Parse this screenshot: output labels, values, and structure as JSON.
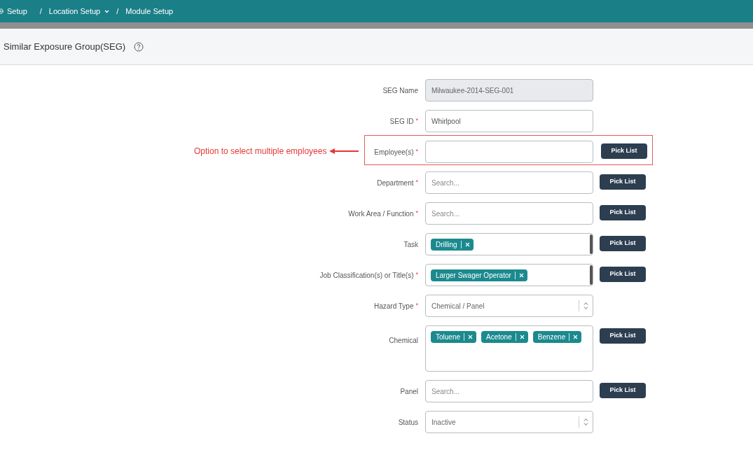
{
  "breadcrumbs": [
    {
      "kind": "home",
      "label": "Setup"
    },
    {
      "kind": "separator",
      "label": "/"
    },
    {
      "kind": "dropdown",
      "label": "Location Setup"
    },
    {
      "kind": "separator",
      "label": "/"
    },
    {
      "kind": "link",
      "label": "Module Setup"
    }
  ],
  "page_title": "Similar Exposure Group(SEG)",
  "fields": [
    {
      "kind": "text",
      "label": "SEG Name",
      "value": "Milwaukee-2014-SEG-001",
      "disabled": true
    },
    {
      "kind": "text",
      "label": "SEG ID",
      "required_mark": "*",
      "value": "Whirlpool",
      "disabled": false
    },
    {
      "kind": "text",
      "label": "Employee(s)",
      "required_mark": "*",
      "disabled": false,
      "pick_list": "Pick List",
      "annotation": "Option to select multiple employees"
    },
    {
      "kind": "text",
      "label": "Department",
      "required_mark": "*",
      "placeholder": "Search...",
      "disabled": false,
      "pick_list": "Pick List"
    },
    {
      "kind": "text",
      "label": "Work Area / Function",
      "required_mark": "*",
      "placeholder": "Search...",
      "disabled": false,
      "pick_list": "Pick List"
    },
    {
      "kind": "tags",
      "label": "Task",
      "tags": [
        "Drilling"
      ],
      "scrollable": true,
      "pick_list": "Pick List"
    },
    {
      "kind": "tags",
      "label": "Job Classification(s) or Title(s)",
      "required_mark": "*",
      "tags": [
        "Larger Swager Operator"
      ],
      "scrollable": true,
      "pick_list": "Pick List"
    },
    {
      "kind": "select",
      "label": "Hazard Type",
      "required_mark": "*",
      "value": "Chemical / Panel"
    },
    {
      "kind": "tags",
      "label": "Chemical",
      "tags": [
        "Toluene",
        "Acetone",
        "Benzene"
      ],
      "scrollable": false,
      "tall": true,
      "pick_list": "Pick List"
    },
    {
      "kind": "text",
      "label": "Panel",
      "placeholder": "Search...",
      "disabled": false,
      "pick_list": "Pick List"
    },
    {
      "kind": "select",
      "label": "Status",
      "value": "Inactive"
    }
  ]
}
